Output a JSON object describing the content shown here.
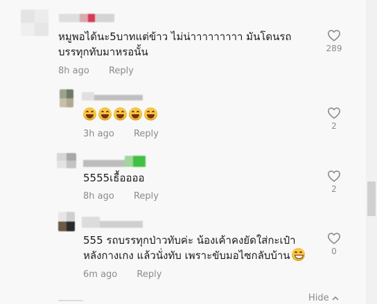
{
  "comments": [
    {
      "text_lines": [
        "หมูพอได้นะ5บาทแต่ข้าว ไม่น่าาาาาาาาา มันโดนรถ",
        "บรรทุกทับมาหรอนั้น"
      ],
      "time": "8h ago",
      "reply_label": "Reply",
      "likes": "289"
    },
    {
      "emoji_count": 5,
      "time": "3h ago",
      "reply_label": "Reply",
      "likes": "2"
    },
    {
      "text_lines": [
        "5555เธื้ออออ"
      ],
      "time": "8h ago",
      "reply_label": "Reply",
      "likes": "2"
    },
    {
      "text_lines": [
        "555 รถบรรทุกป่าวทับค่ะ น้องเค้าคงยัดใส่กะเป๋า",
        "หลังกางเกง แล้วนั่งทับ เพราะขับมอไซกลับบ้าน"
      ],
      "time": "6m ago",
      "reply_label": "Reply",
      "likes": "0"
    }
  ],
  "hide_label": "Hide",
  "icons": {
    "like": "heart-outline-icon",
    "hide": "chevron-up-icon",
    "emoji": "face-with-tears-of-joy-emoji"
  },
  "colors": {
    "background": "#f8f8f8",
    "text": "#1a1a1a",
    "muted": "#8a8b91"
  }
}
